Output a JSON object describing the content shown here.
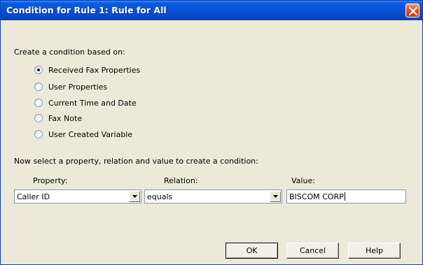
{
  "window": {
    "title": "Condition for Rule 1: Rule for All",
    "close_icon": "close-icon"
  },
  "section1": {
    "heading": "Create a condition based on:",
    "options": [
      {
        "label": "Received Fax Properties",
        "checked": true
      },
      {
        "label": "User Properties",
        "checked": false
      },
      {
        "label": "Current Time and Date",
        "checked": false
      },
      {
        "label": "Fax Note",
        "checked": false
      },
      {
        "label": "User Created Variable",
        "checked": false
      }
    ]
  },
  "section2": {
    "heading": "Now select a property, relation and value to create a condition:",
    "property_label": "Property:",
    "relation_label": "Relation:",
    "value_label": "Value:",
    "property_value": "Caller ID",
    "relation_value": "equals",
    "value_value": "BISCOM CORP"
  },
  "buttons": {
    "ok": "OK",
    "cancel": "Cancel",
    "help": "Help"
  },
  "colors": {
    "title_bar": "#0653d6",
    "dialog_bg": "#ece9d8",
    "close_button": "#d9542c"
  }
}
